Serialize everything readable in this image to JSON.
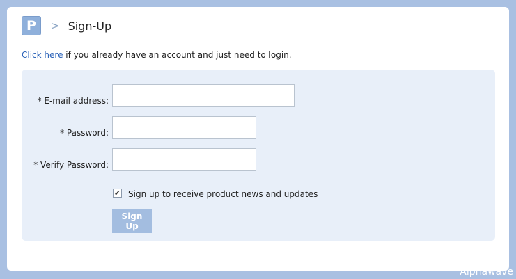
{
  "header": {
    "logo_letter": "P",
    "separator": ">",
    "title": "Sign-Up"
  },
  "login_prompt": {
    "link_text": "Click here",
    "rest_text": " if you already have an account and just need to login."
  },
  "form": {
    "email_label": "* E-mail address:",
    "email_value": "",
    "password_label": "* Password:",
    "password_value": "",
    "verify_label": "* Verify Password:",
    "verify_value": "",
    "newsletter_checked": true,
    "newsletter_label": "Sign up to receive product news and updates",
    "submit_label": "Sign Up"
  },
  "watermark": "Alphawave",
  "colors": {
    "background": "#a9c0e2",
    "panel": "#e8eff9",
    "link": "#2a62b8",
    "button": "#a3bde0"
  }
}
